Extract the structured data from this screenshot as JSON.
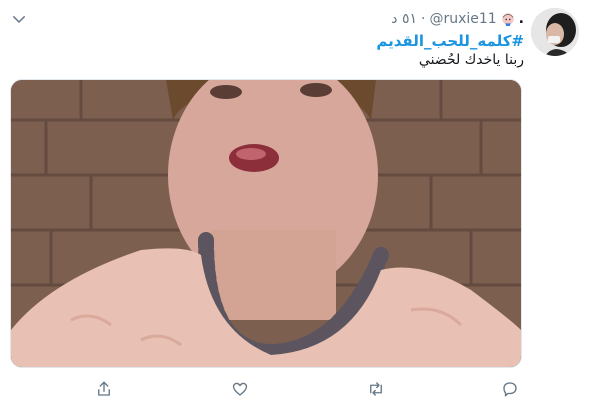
{
  "tweet": {
    "display_name": ".",
    "handle": "@ruxie11",
    "time": "٥١ د",
    "separator": "·",
    "hashtag": "#كلمه_للحب_القديم",
    "text": "ربنا ياخدك لحُضني"
  },
  "icons": {
    "menu": "chevron-down-icon",
    "badge": "emoji-badge-icon",
    "share": "share-icon",
    "like": "heart-icon",
    "retweet": "retweet-icon",
    "reply": "reply-icon"
  },
  "colors": {
    "link": "#1b95e0",
    "secondary_text": "#657786",
    "primary_text": "#14171a"
  }
}
